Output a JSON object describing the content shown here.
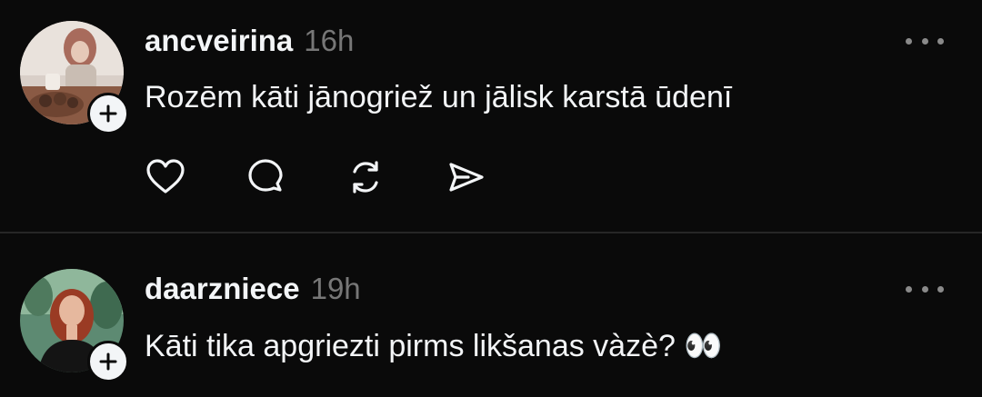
{
  "posts": [
    {
      "username": "ancveirina",
      "time": "16h",
      "text": "Rozēm kāti jānogriež un jālisk karstā ūdenī",
      "avatar_icon": "profile-photo",
      "follow_icon": "plus-icon",
      "actions": [
        "heart-icon",
        "comment-icon",
        "repost-icon",
        "share-icon"
      ]
    },
    {
      "username": "daarzniece",
      "time": "19h",
      "text": "Kāti tika apgriezti pirms likšanas vàzè? 👀",
      "avatar_icon": "profile-photo",
      "follow_icon": "plus-icon"
    }
  ],
  "colors": {
    "background": "#0a0a0a",
    "text": "#f3f5f7",
    "muted": "#777777",
    "divider": "#262626"
  }
}
